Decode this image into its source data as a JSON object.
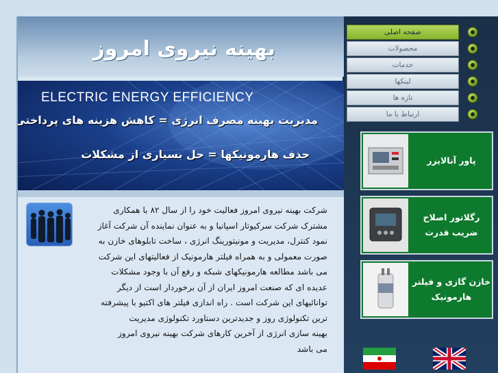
{
  "header": {
    "title": "بهینه نیروی امروز"
  },
  "banner": {
    "english": "ELECTRIC ENERGY EFFICIENCY",
    "line1": "مدیریت بهینه مصرف انرژی = کاهش هزینه های پرداختی",
    "line2": "حذف هارمونیکها = حل بسیاری از مشکلات"
  },
  "nav": {
    "items": [
      {
        "label": "صفحه اصلی",
        "active": true
      },
      {
        "label": "محصولات",
        "active": false
      },
      {
        "label": "خدمات",
        "active": false
      },
      {
        "label": "لینکها",
        "active": false
      },
      {
        "label": "تازه ها",
        "active": false
      },
      {
        "label": "ارتباط با ما",
        "active": false
      }
    ]
  },
  "products": [
    {
      "label": "پاور آنالایزر"
    },
    {
      "label": "رگلاتور اصلاح ضریب قدرت"
    },
    {
      "label": "خازن گازی و فیلتر هارمونیک"
    }
  ],
  "body": {
    "lines": [
      "شرکت بهینه نیروی امروز فعالیت خود را از سال ۸۲ با همکاری",
      "مشترک  شرکت سرکیوتار  اسپانیا و به عنوان نماینده آن شرکت آغاز",
      "نمود کنترل، مدیریت و مونیتورینگ انرژی ، ساخت تابلوهای خازن به",
      "صورت معمولی و به همراه فیلتر هارمونیک  از فعالیتهای این شرکت",
      "می باشد  مطالعه هارمونیکهای شبکه و رفع آن با وجود مشکلات",
      "عدیده ای که صنعت امروز ایران از آن برخوردار است از دیگر",
      "توانائیهای این شرکت است . راه اندازی فیلتر های اکتیو با پیشرفته",
      "ترین تکنولوژی روز و جدیدترین  دستاورد تکنولوژی مدیریت",
      "بهینه سازی انرژی از آخرین کارهای شرکت بهینه نیروی امروز",
      "می باشد"
    ]
  },
  "colors": {
    "nav_active": "#9cc43f",
    "card_bg": "#0e7a2e",
    "banner": "#1a3f8a"
  },
  "icons": {
    "nav_bullet": "green-bullet-icon",
    "flag_iran": "iran-flag-icon",
    "flag_uk": "uk-flag-icon"
  }
}
